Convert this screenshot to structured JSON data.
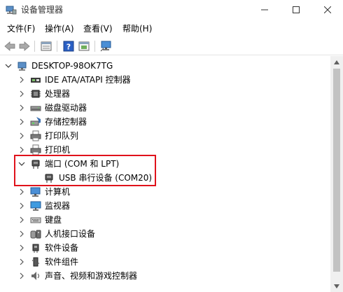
{
  "window": {
    "title": "设备管理器"
  },
  "menu": {
    "items": [
      "文件(F)",
      "操作(A)",
      "查看(V)",
      "帮助(H)"
    ]
  },
  "toolbar": {
    "buttons": [
      "back-arrow-icon",
      "forward-arrow-icon",
      "properties-icon",
      "help-icon",
      "update-driver-icon",
      "monitor-scan-icon"
    ]
  },
  "tree": {
    "root": "DESKTOP-98OK7TG",
    "categories": [
      {
        "label": "IDE ATA/ATAPI 控制器",
        "icon": "ide-controller-icon",
        "expanded": false
      },
      {
        "label": "处理器",
        "icon": "processor-icon",
        "expanded": false
      },
      {
        "label": "磁盘驱动器",
        "icon": "disk-drive-icon",
        "expanded": false
      },
      {
        "label": "存储控制器",
        "icon": "storage-controller-icon",
        "expanded": false
      },
      {
        "label": "打印队列",
        "icon": "print-queue-icon",
        "expanded": false
      },
      {
        "label": "打印机",
        "icon": "printer-icon",
        "expanded": false
      },
      {
        "label": "端口 (COM 和 LPT)",
        "icon": "port-icon",
        "expanded": true
      },
      {
        "label": "USB 串行设备 (COM20)",
        "icon": "port-device-icon",
        "child": true
      },
      {
        "label": "计算机",
        "icon": "computer-icon",
        "expanded": false
      },
      {
        "label": "监视器",
        "icon": "monitor-icon",
        "expanded": false
      },
      {
        "label": "键盘",
        "icon": "keyboard-icon",
        "expanded": false
      },
      {
        "label": "人机接口设备",
        "icon": "hid-icon",
        "expanded": false
      },
      {
        "label": "软件设备",
        "icon": "software-device-icon",
        "expanded": false
      },
      {
        "label": "软件组件",
        "icon": "software-component-icon",
        "expanded": false
      },
      {
        "label": "声音、视频和游戏控制器",
        "icon": "sound-icon",
        "expanded": false
      }
    ]
  },
  "colors": {
    "highlight": "#e0121b",
    "accent": "#1f6fc0"
  }
}
